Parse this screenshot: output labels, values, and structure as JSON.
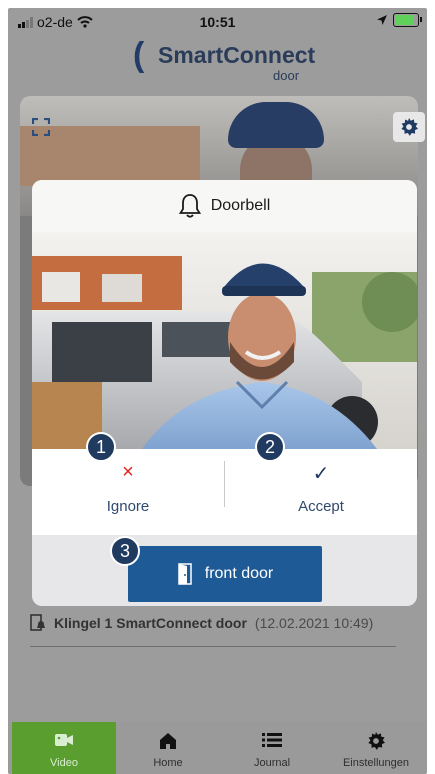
{
  "status_bar": {
    "carrier": "o2-de",
    "time": "10:51"
  },
  "logo": {
    "name": "SmartConnect",
    "sub": "door"
  },
  "modal": {
    "title": "Doorbell",
    "ignore_label": "Ignore",
    "ignore_glyph": "×",
    "accept_label": "Accept",
    "accept_glyph": "✓",
    "door_button_label": "front door",
    "badges": [
      "1",
      "2",
      "3"
    ]
  },
  "history": {
    "title": "Klingel 1 SmartConnect door",
    "date": "(12.02.2021 10:49)"
  },
  "tabs": [
    {
      "label": "Video",
      "icon": "video-icon"
    },
    {
      "label": "Home",
      "icon": "home-icon"
    },
    {
      "label": "Journal",
      "icon": "list-icon"
    },
    {
      "label": "Einstellungen",
      "icon": "gear-icon"
    }
  ],
  "colors": {
    "accent_green": "#5a9e2f",
    "navy": "#203a60",
    "door_blue": "#1e5a95",
    "ignore_red": "#e0251b"
  }
}
